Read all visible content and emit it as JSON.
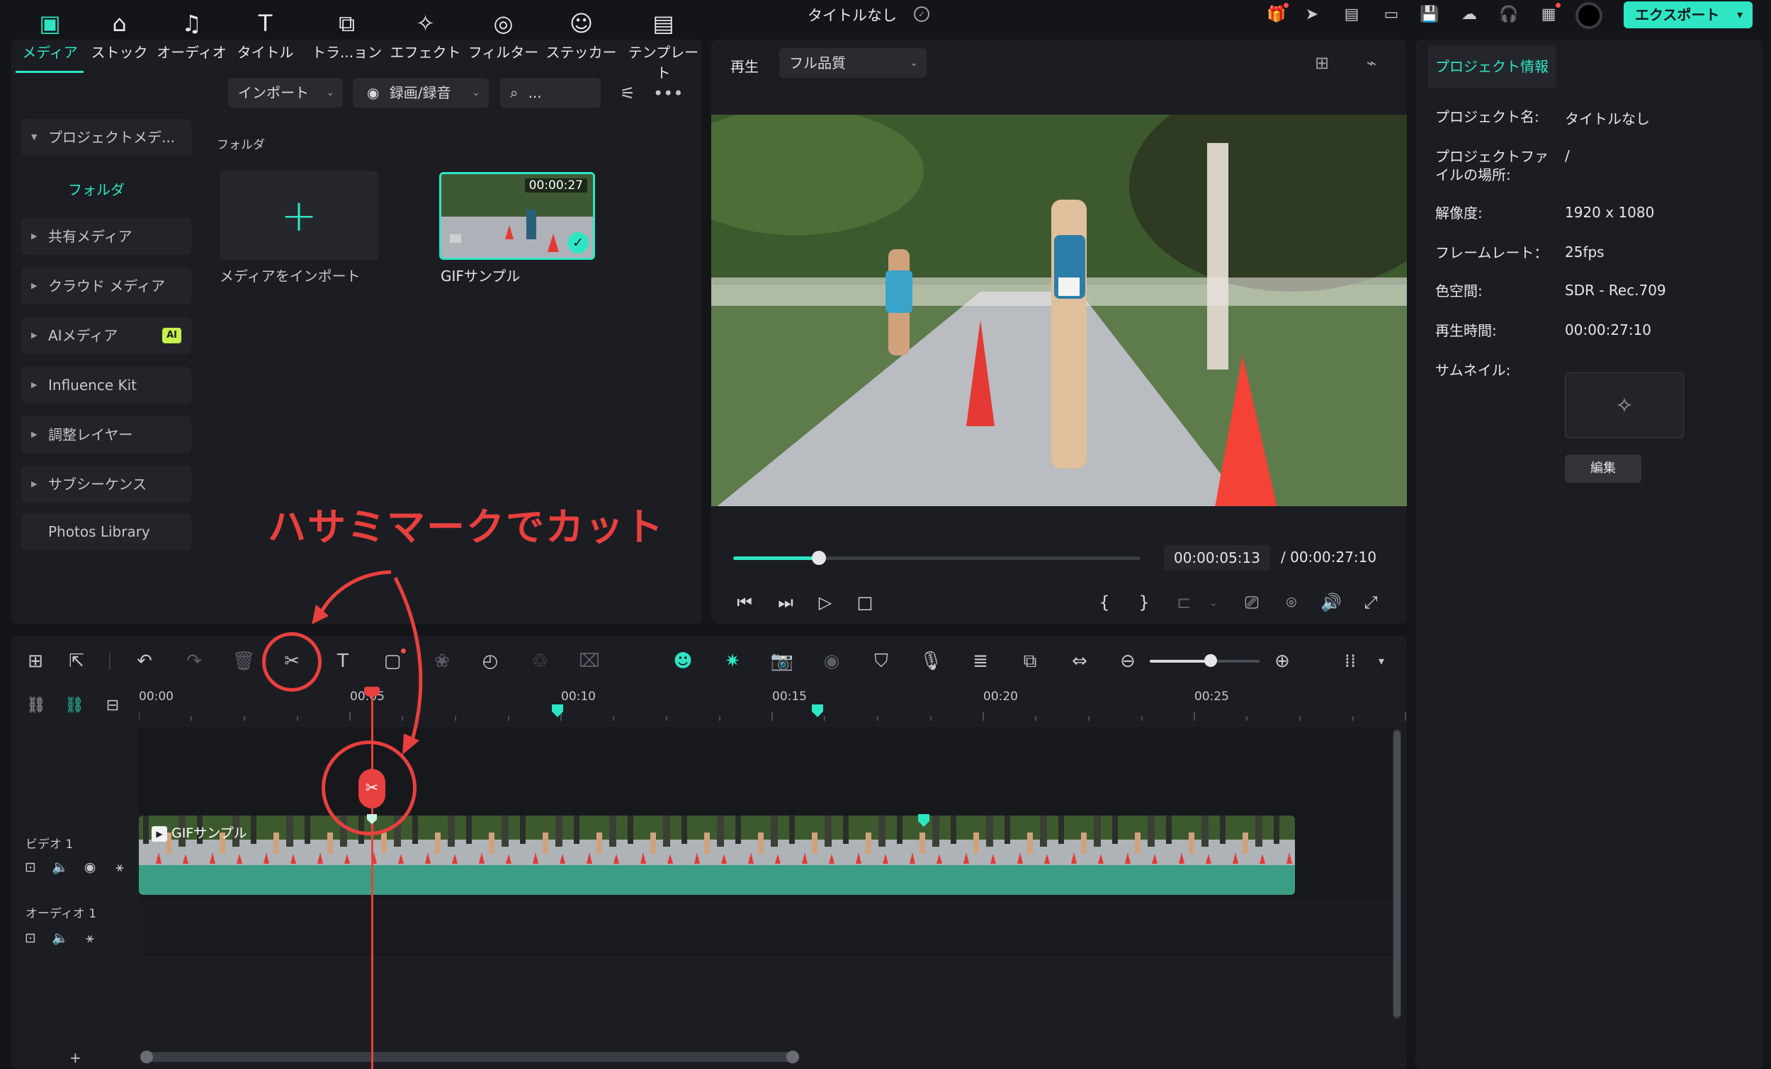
{
  "app": {
    "title": "タイトルなし",
    "export_label": "エクスポート"
  },
  "top_icons": [
    "gift-icon",
    "send-icon",
    "subtitle-icon",
    "layout-icon",
    "save-icon",
    "cloud-upload-icon",
    "headset-icon",
    "apps-grid-icon"
  ],
  "media_toolbar": {
    "items": [
      {
        "label": "メディア",
        "icon": "media-icon"
      },
      {
        "label": "ストック",
        "icon": "stock-icon"
      },
      {
        "label": "オーディオ",
        "icon": "music-icon"
      },
      {
        "label": "タイトル",
        "icon": "title-icon"
      },
      {
        "label": "トラ...ョン",
        "icon": "transition-icon"
      },
      {
        "label": "エフェクト",
        "icon": "effect-icon"
      },
      {
        "label": "フィルター",
        "icon": "filter-icon"
      },
      {
        "label": "ステッカー",
        "icon": "sticker-icon"
      },
      {
        "label": "テンプレート",
        "icon": "template-icon"
      }
    ]
  },
  "sidebar": {
    "items": [
      {
        "label": "プロジェクトメデ..."
      },
      {
        "label": "共有メディア"
      },
      {
        "label": "クラウド メディア"
      },
      {
        "label": "AIメディア",
        "badge": "AI"
      },
      {
        "label": "Influence Kit"
      },
      {
        "label": "調整レイヤー"
      },
      {
        "label": "サブシーケンス"
      },
      {
        "label": "Photos Library"
      }
    ],
    "folder_label": "フォルダ"
  },
  "media": {
    "import_label": "インポート",
    "record_label": "録画/録音",
    "search_placeholder": "...",
    "folder_header": "フォルダ",
    "import_tile_label": "メディアをインポート",
    "clip": {
      "name": "GIFサンプル",
      "duration": "00:00:27"
    }
  },
  "annotation": {
    "text": "ハサミマークでカット"
  },
  "viewer": {
    "play_label": "再生",
    "quality": "フル品質",
    "current_time": "00:00:05:13",
    "total_time": "/ 00:00:27:10",
    "progress": 0.21
  },
  "info": {
    "tab_label": "プロジェクト情報",
    "rows": [
      {
        "key": "プロジェクト名:",
        "value": "タイトルなし"
      },
      {
        "key": "プロジェクトファ\nイルの場所:",
        "value": "/"
      },
      {
        "key": "解像度:",
        "value": "1920 x 1080"
      },
      {
        "key": "フレームレート：",
        "value": "25fps"
      },
      {
        "key": "色空間:",
        "value": "SDR - Rec.709"
      },
      {
        "key": "再生時間:",
        "value": "00:00:27:10"
      },
      {
        "key": "サムネイル:",
        "value": ""
      }
    ],
    "edit_label": "編集"
  },
  "timeline": {
    "ruler": [
      "00:00",
      "00:05",
      "00:10",
      "00:15",
      "00:20",
      "00:25"
    ],
    "tracks": [
      {
        "name": "ビデオ 1"
      },
      {
        "name": "オーディオ 1"
      }
    ],
    "clip_title": "GIFサンプル",
    "zoom_level": 0.55,
    "add_track": "+"
  },
  "colors": {
    "accent": "#2ee6c4",
    "annotation": "#e8403e",
    "background": "#141519",
    "panel": "#1c1d22"
  }
}
